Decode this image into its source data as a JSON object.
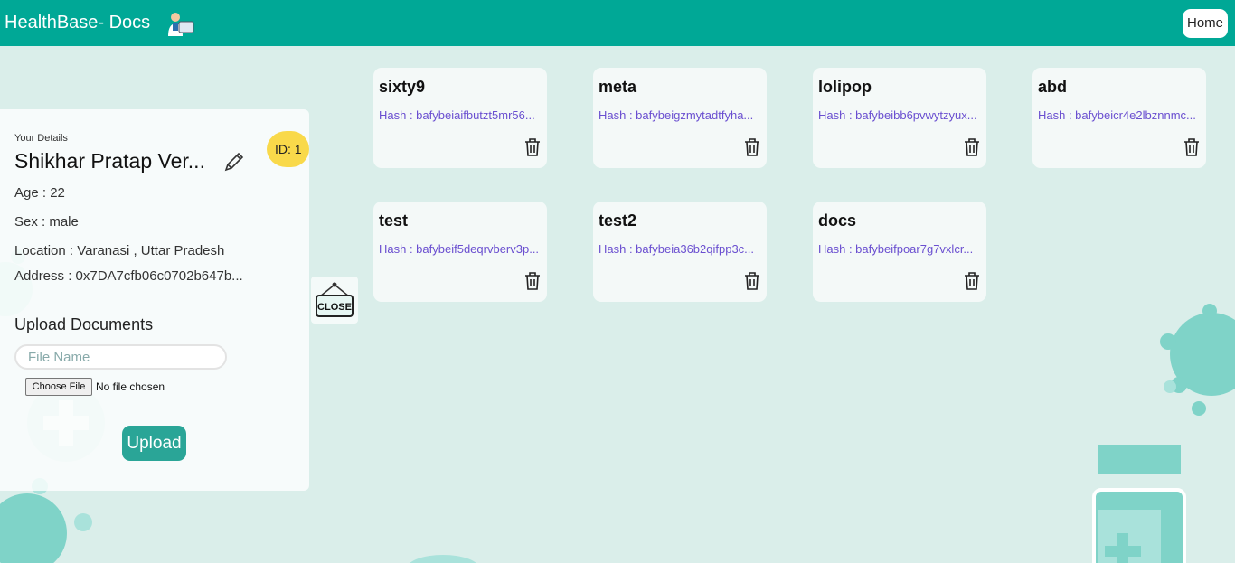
{
  "navbar": {
    "brand": "HealthBase- Docs",
    "home_label": "Home"
  },
  "profile": {
    "section_label": "Your Details",
    "name": "Shikhar Pratap Ver...",
    "id_badge": "ID: 1",
    "age": "Age : 22",
    "sex": "Sex : male",
    "location": "Location : Varanasi , Uttar Pradesh",
    "address": "Address : 0x7DA7cfb06c0702b647b..."
  },
  "upload": {
    "title": "Upload Documents",
    "file_name_placeholder": "File Name",
    "choose_file_label": "Choose File",
    "no_file_text": "No file chosen",
    "upload_label": "Upload"
  },
  "close_sign": {
    "label": "CLOSE"
  },
  "documents": [
    {
      "title": "sixty9",
      "hash": "Hash : bafybeiaifbutzt5mr56..."
    },
    {
      "title": "meta",
      "hash": "Hash : bafybeigzmytadtfyha..."
    },
    {
      "title": "lolipop",
      "hash": "Hash : bafybeibb6pvwytzyux..."
    },
    {
      "title": "abd",
      "hash": "Hash : bafybeicr4e2lbznnmc..."
    },
    {
      "title": "test",
      "hash": "Hash : bafybeif5deqrvberv3p..."
    },
    {
      "title": "test2",
      "hash": "Hash : bafybeia36b2qifpp3c..."
    },
    {
      "title": "docs",
      "hash": "Hash : bafybeifpoar7g7vxlcr..."
    }
  ],
  "colors": {
    "navbar": "#00a896",
    "background": "#daeeea",
    "accent": "#2aa597",
    "id_badge": "#f9d94a",
    "hash_text": "#6a4fd0"
  }
}
